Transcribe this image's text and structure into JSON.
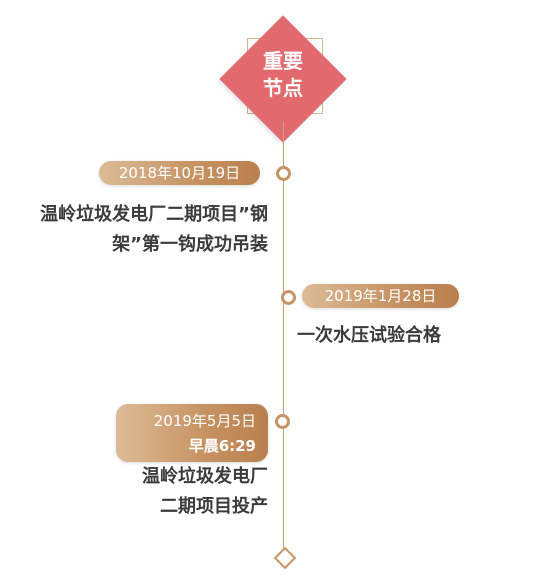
{
  "header": {
    "line1": "重要",
    "line2": "节点"
  },
  "events": [
    {
      "date": "2018年10月19日",
      "title_line1": "温岭垃圾发电厂二期项目”钢",
      "title_line2": "架”第一钩成功吊装"
    },
    {
      "date": "2019年1月28日",
      "title_line1": "一次水压试验合格"
    },
    {
      "date": "2019年5月5日",
      "time": "早晨6:29",
      "title_line1": "温岭垃圾发电厂",
      "title_line2": "二期项目投产"
    }
  ],
  "colors": {
    "accent_red": "#e26a6f",
    "accent_gold": "#c79466",
    "text": "#3b3b3b"
  }
}
